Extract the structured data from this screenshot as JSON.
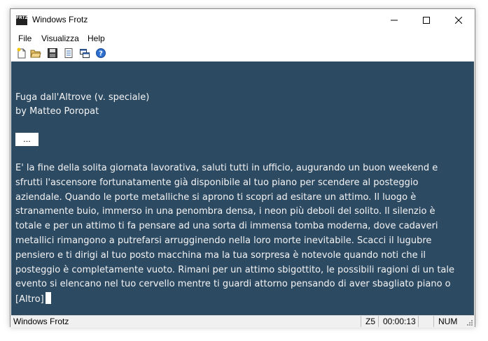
{
  "window": {
    "title": "Windows Frotz",
    "app_icon_text": "FRTZ",
    "controls": {
      "minimize": "—",
      "maximize": "☐",
      "close": "✕"
    }
  },
  "menu": {
    "items": [
      "File",
      "Visualizza",
      "Help"
    ]
  },
  "toolbar": {
    "buttons": [
      "new-icon",
      "open-icon",
      "save-icon",
      "info-icon",
      "windows-icon",
      "help-icon"
    ]
  },
  "game": {
    "title": "Fuga dall'Altrove (v. speciale)",
    "author": "by Matteo Poropat",
    "more_prompt": "...",
    "paragraph_lines": [
      "E' la fine della solita giornata lavorativa, saluti tutti in ufficio, augurando un buon weekend e",
      "sfrutti l'ascensore fortunatamente già disponibile al tuo piano per scendere al posteggio",
      "aziendale. Quando le porte metalliche si aprono ti scopri ad esitare un attimo. Il luogo è",
      "stranamente buio, immerso in una penombra densa, i neon più deboli del solito. Il silenzio è",
      "totale e per un attimo ti fa pensare ad una sorta di immensa tomba moderna, dove cadaveri",
      "metallici rimangono a putrefarsi arrugginendo nella loro morte inevitabile. Scacci il lugubre",
      "pensiero e  ti dirigi al tuo posto macchina ma la tua sorpresa è notevole quando noti che il",
      "posteggio è completamente vuoto. Rimani per un attimo sbigottito, le possibili ragioni di un tale",
      "evento si elencano nel tuo cervello mentre ti guardi attorno pensando di aver sbagliato piano o"
    ],
    "last_line": "[Altro]"
  },
  "status": {
    "left": "Windows Frotz",
    "z": "Z5",
    "time": "00:00:13",
    "num": "NUM"
  },
  "colors": {
    "content_bg": "#2d4a63",
    "content_text": "#f4f4f4"
  }
}
